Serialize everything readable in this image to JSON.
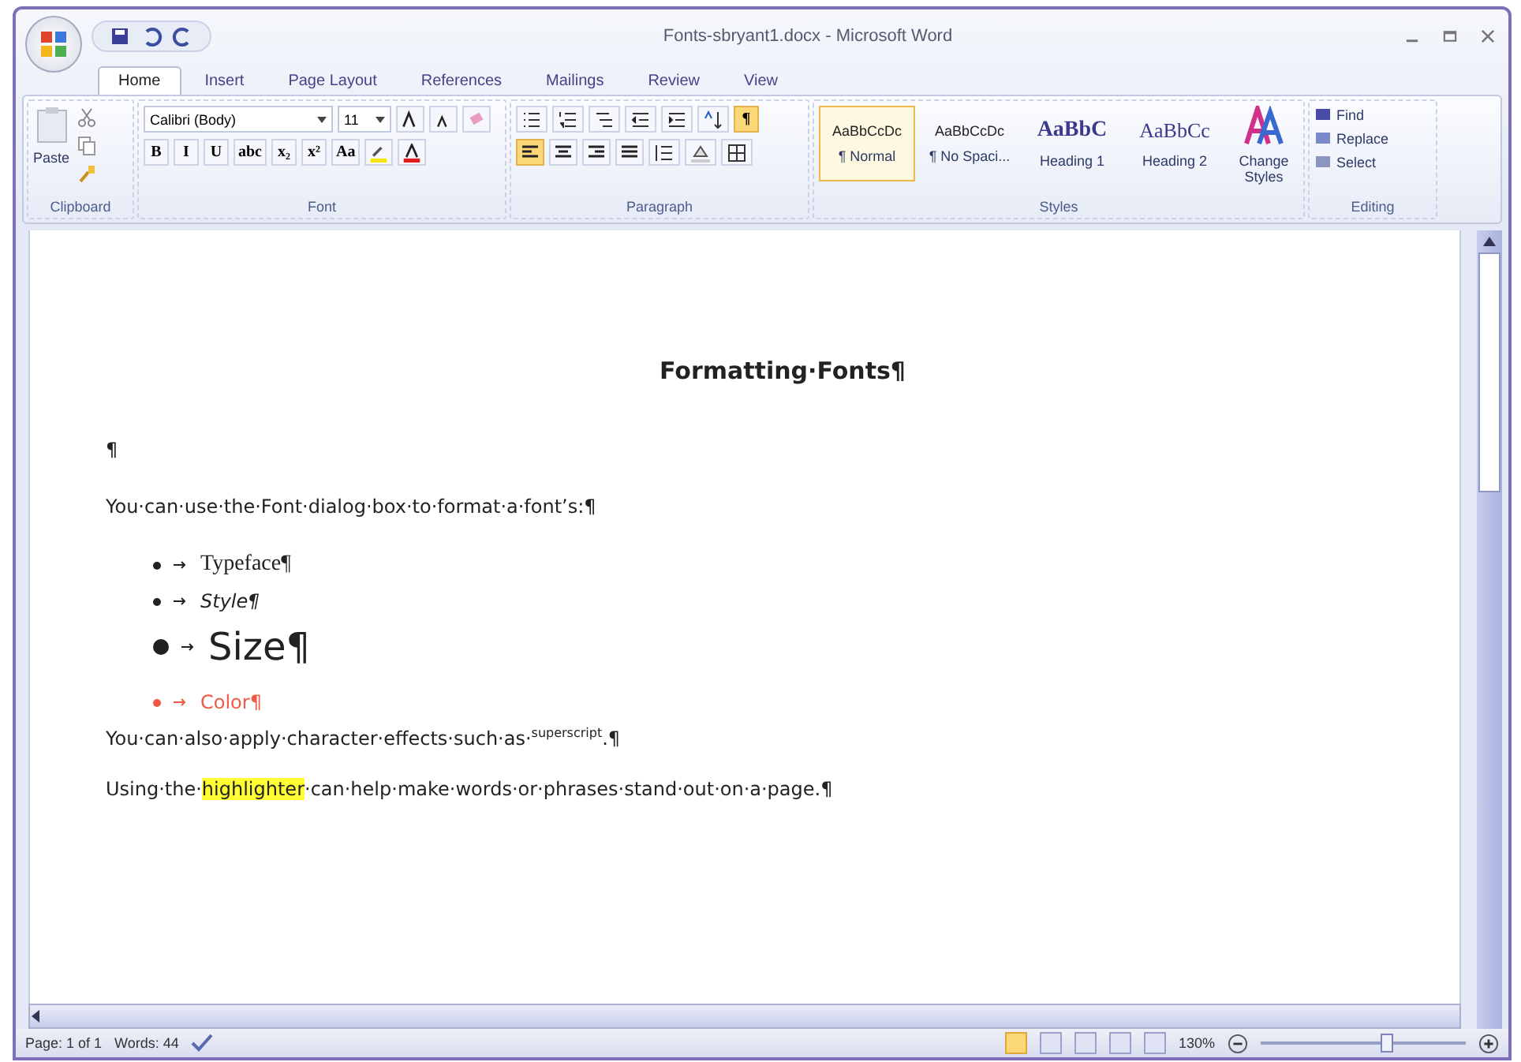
{
  "window": {
    "title": "Fonts-sbryant1.docx - Microsoft Word"
  },
  "tabs": [
    {
      "label": "Home",
      "selected": true
    },
    {
      "label": "Insert",
      "selected": false
    },
    {
      "label": "Page Layout",
      "selected": false
    },
    {
      "label": "References",
      "selected": false
    },
    {
      "label": "Mailings",
      "selected": false
    },
    {
      "label": "Review",
      "selected": false
    },
    {
      "label": "View",
      "selected": false
    }
  ],
  "clipboard": {
    "paste_label": "Paste",
    "group_label": "Clipboard"
  },
  "font": {
    "font_name": "Calibri (Body)",
    "font_size": "11",
    "format_buttons": [
      "B",
      "I",
      "U",
      "abc",
      "x₂",
      "x²",
      "Aa"
    ],
    "group_label": "Font"
  },
  "paragraph": {
    "group_label": "Paragraph",
    "show_marks": {
      "label": "¶",
      "selected": true
    },
    "alignments": [
      {
        "selected": true
      },
      {
        "selected": false
      },
      {
        "selected": false
      },
      {
        "selected": false
      }
    ]
  },
  "styles": {
    "group_label": "Styles",
    "items": [
      {
        "sample": "AaBbCcDc",
        "name": "¶ Normal",
        "kind": "normal",
        "selected": true
      },
      {
        "sample": "AaBbCcDc",
        "name": "¶ No Spaci...",
        "kind": "normal",
        "selected": false
      },
      {
        "sample": "AaBbC",
        "name": "Heading 1",
        "kind": "heading1",
        "selected": false
      },
      {
        "sample": "AaBbCc",
        "name": "Heading 2",
        "kind": "heading2",
        "selected": false
      }
    ],
    "change_styles": "Change Styles"
  },
  "editing": {
    "group_label": "Editing",
    "items": [
      "Find",
      "Replace",
      "Select"
    ]
  },
  "document": {
    "title": "Formatting·Fonts¶",
    "paragraphs": [
      {
        "kind": "empty",
        "text": "¶"
      },
      {
        "kind": "body",
        "text": "You·can·use·the·Font·dialog·box·to·format·a·font’s:¶"
      },
      {
        "kind": "bullet_serif",
        "text": "Typeface¶"
      },
      {
        "kind": "bullet_italic",
        "text": "Style¶"
      },
      {
        "kind": "bullet_large",
        "text": "Size¶"
      },
      {
        "kind": "bullet_colored",
        "color": "#ee5a45",
        "text": "Color¶"
      },
      {
        "kind": "body",
        "text": "You·can·also·apply·character·effects·such·as·$^{superscript}$.¶"
      },
      {
        "kind": "segments",
        "segments": [
          {
            "text": "Using·the·",
            "highlighted": false
          },
          {
            "text": "highlighter",
            "highlighted": true
          },
          {
            "text": "·can·help·make·words·or·phrases·stand·out·on·a·page.¶",
            "highlighted": false
          }
        ]
      }
    ]
  },
  "status_bar": {
    "page": "Page: 1 of 1",
    "words": "Words: 44",
    "zoom": "130%",
    "zoom_slider": {
      "level": 0.62
    },
    "views": [
      {
        "selected": true
      },
      {
        "selected": false
      },
      {
        "selected": false
      },
      {
        "selected": false
      },
      {
        "selected": false
      }
    ]
  }
}
